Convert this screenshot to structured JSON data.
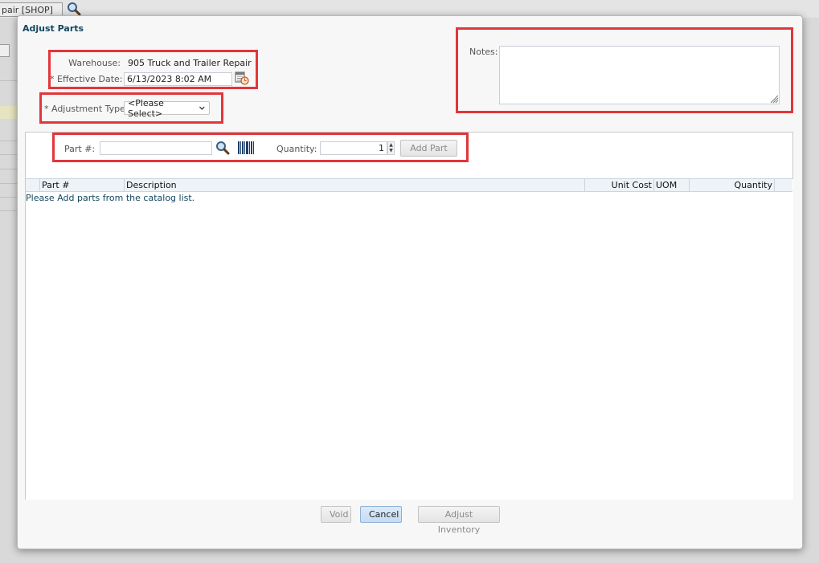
{
  "background": {
    "tab_text": "pair [SHOP]"
  },
  "modal": {
    "title": "Adjust Parts",
    "warehouse_label": "Warehouse:",
    "warehouse_value": "905 Truck and Trailer Repair",
    "effective_date_label": "* Effective Date:",
    "effective_date_value": "6/13/2023 8:02 AM",
    "adjustment_type_label": "* Adjustment Type:",
    "adjustment_type_value": "<Please Select>",
    "notes_label": "Notes:",
    "notes_value": "",
    "part_label": "Part #:",
    "part_value": "",
    "quantity_label": "Quantity:",
    "quantity_value": "1",
    "add_part_label": "Add Part",
    "grid": {
      "columns": [
        "Part #",
        "Description",
        "Unit Cost",
        "UOM",
        "Quantity"
      ],
      "empty_message": "Please Add parts from the catalog list."
    },
    "buttons": {
      "void": "Void",
      "cancel": "Cancel",
      "adjust_inventory": "Adjust Inventory"
    }
  },
  "colors": {
    "highlight": "#e3353a",
    "title": "#15465f",
    "primary_button": "#c4dcf2"
  },
  "icons": [
    "search-icon",
    "barcode-icon",
    "calendar-clock-icon",
    "resize-grip-icon",
    "spinner-up-icon",
    "spinner-down-icon",
    "chevron-down-icon"
  ]
}
